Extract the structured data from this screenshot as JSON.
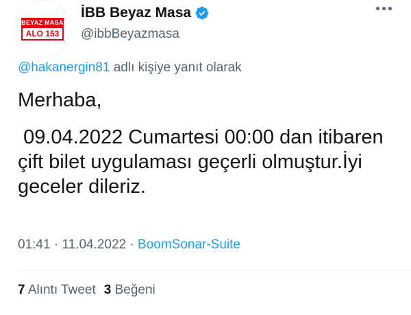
{
  "account": {
    "display_name": "İBB Beyaz Masa",
    "handle": "@ibbBeyazmasa",
    "verified": true,
    "avatar_logo": {
      "top_text": "BEYAZ MASA",
      "bottom_text": "ALO 153"
    }
  },
  "reply": {
    "mention": "@hakanergin81",
    "suffix": " adlı kişiye yanıt olarak"
  },
  "tweet": {
    "paragraph_1": "Merhaba,",
    "paragraph_2": " 09.04.2022 Cumartesi 00:00 dan itibaren çift bilet uygulaması geçerli olmuştur.İyi geceler dileriz."
  },
  "meta": {
    "time": "01:41",
    "separator_1": " · ",
    "date": "11.04.2022",
    "separator_2": " · ",
    "source": "BoomSonar-Suite"
  },
  "stats": {
    "quote_count": "7",
    "quote_label": "Alıntı Tweet",
    "like_count": "3",
    "like_label": "Beğeni"
  },
  "colors": {
    "accent": "#1d9bf0",
    "secondary_text": "#536471",
    "brand_red": "#e30613"
  },
  "icons": {
    "verified": "verified-badge-icon",
    "more": "more-options-icon"
  }
}
